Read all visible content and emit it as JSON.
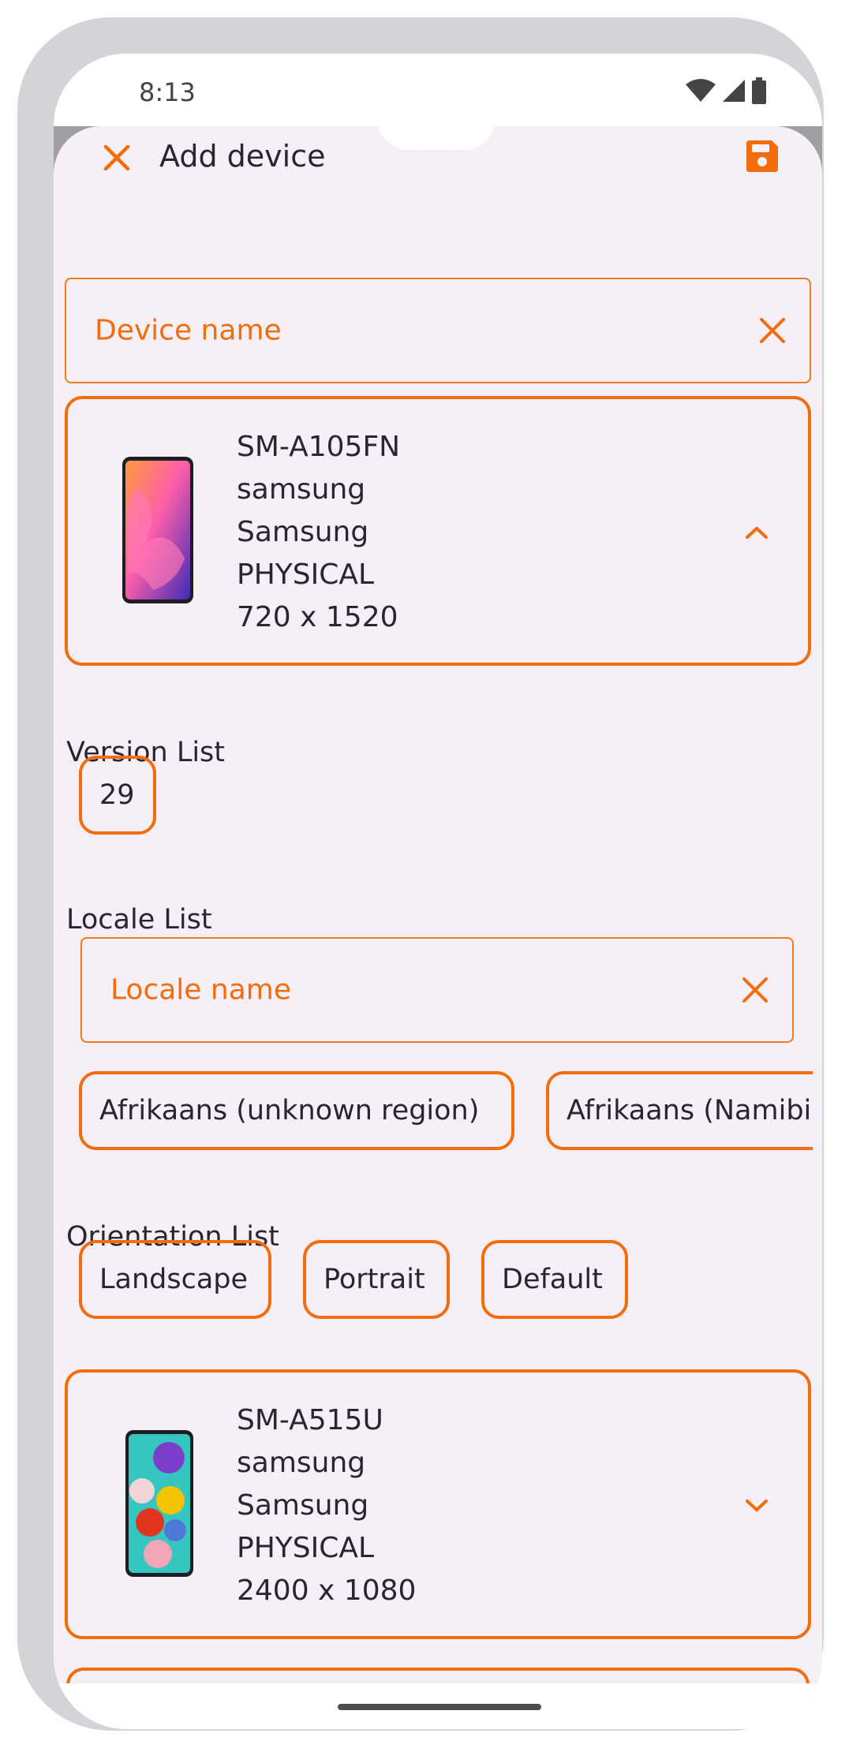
{
  "status_bar": {
    "time": "8:13"
  },
  "app_bar": {
    "title": "Add device"
  },
  "device_name_field": {
    "label": "Device name"
  },
  "devices": [
    {
      "model": "SM-A105FN",
      "brand": "samsung",
      "manufacturer": "Samsung",
      "form_factor": "PHYSICAL",
      "resolution": "720 x 1520",
      "expanded": true
    },
    {
      "model": "SM-A515U",
      "brand": "samsung",
      "manufacturer": "Samsung",
      "form_factor": "PHYSICAL",
      "resolution": "2400 x 1080",
      "expanded": false
    }
  ],
  "version_list": {
    "label": "Version List",
    "chips": [
      "29"
    ]
  },
  "locale_list": {
    "label": "Locale List",
    "field_label": "Locale name",
    "chips": [
      "Afrikaans (unknown region)",
      "Afrikaans (Namibia)"
    ]
  },
  "orientation_list": {
    "label": "Orientation List",
    "chips": [
      "Landscape",
      "Portrait",
      "Default"
    ]
  },
  "colors": {
    "accent": "#f26d0a",
    "background": "#f6eff7",
    "frame": "#d3d3d8"
  }
}
